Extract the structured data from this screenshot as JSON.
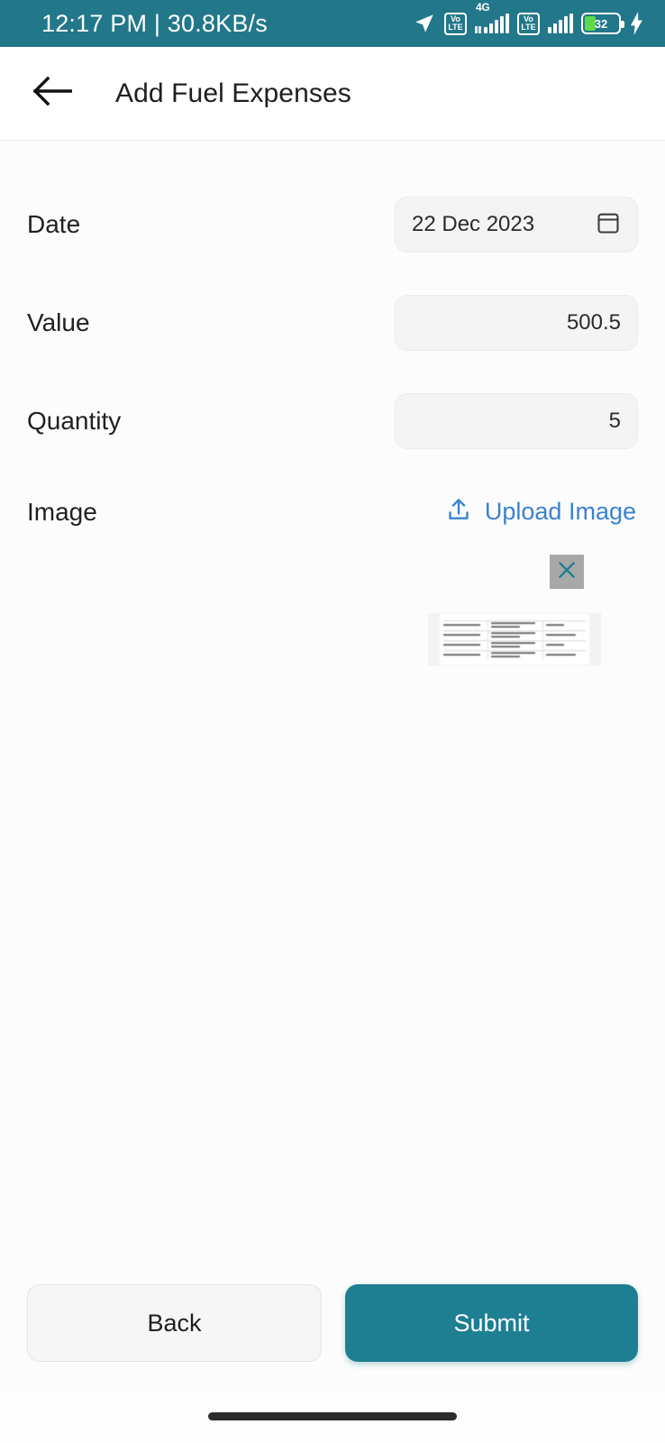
{
  "status_bar": {
    "clock": "12:17 PM | 30.8KB/s",
    "time": "12:17 PM",
    "network_speed": "30.8KB/s",
    "background_color": "#22778a",
    "icons": {
      "location": "location-arrow-icon",
      "volte_1": {
        "line1": "Vo",
        "line2": "LTE"
      },
      "network_type": "4G",
      "volte_2": {
        "line1": "Vo",
        "line2": "LTE"
      },
      "charging": "charging-bolt-icon"
    },
    "battery": {
      "percent": "32",
      "level": 32,
      "fill_color": "#5ed94a",
      "charging": true
    }
  },
  "app_bar": {
    "back_icon": "arrow-left-icon",
    "title": "Add Fuel Expenses"
  },
  "form": {
    "date": {
      "label": "Date",
      "value": "22 Dec 2023",
      "placeholder": "Select date",
      "icon": "calendar-icon"
    },
    "value": {
      "label": "Value",
      "value": "500.5",
      "placeholder": "0"
    },
    "quantity": {
      "label": "Quantity",
      "value": "5",
      "placeholder": "0"
    },
    "image": {
      "label": "Image",
      "upload_label": "Upload Image",
      "upload_icon": "upload-icon",
      "upload_color": "#3b82d0",
      "remove_icon": "close-x-icon",
      "remove_bg_color": "#a8a8a8",
      "remove_x_color": "#1e7f92",
      "preview_alt": "uploaded-document-thumbnail"
    }
  },
  "actions": {
    "back_label": "Back",
    "submit_label": "Submit",
    "submit_color": "#1e7f92"
  },
  "navigation": {
    "gesture_pill": "home-gesture-pill"
  }
}
